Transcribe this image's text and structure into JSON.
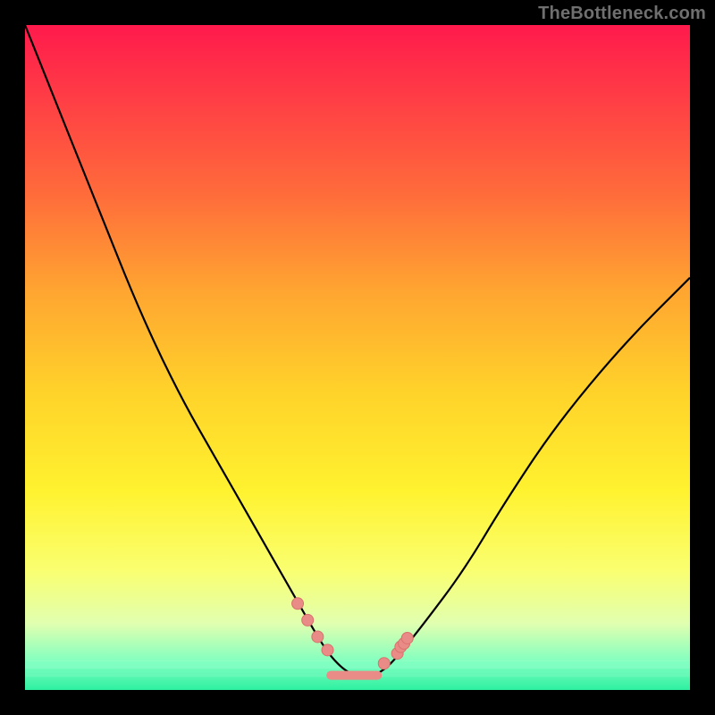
{
  "watermark": "TheBottleneck.com",
  "colors": {
    "black": "#000000",
    "curve": "#000000",
    "marker_fill": "#e98b86",
    "marker_stroke": "#d9726c",
    "marker_segment": "#e98b86"
  },
  "chart_data": {
    "type": "line",
    "title": "",
    "xlabel": "",
    "ylabel": "",
    "xlim": [
      0,
      100
    ],
    "ylim": [
      0,
      100
    ],
    "grid": false,
    "legend": false,
    "series": [
      {
        "name": "bottleneck-curve",
        "x": [
          0,
          4,
          8,
          12,
          16,
          20,
          24,
          28,
          32,
          36,
          40,
          44,
          46,
          48,
          50,
          52,
          54,
          56,
          60,
          66,
          72,
          80,
          90,
          100
        ],
        "y": [
          100,
          90,
          80,
          70,
          60,
          51,
          43,
          36,
          29,
          22,
          15,
          8,
          5,
          3,
          2,
          2,
          3,
          5,
          10,
          18,
          28,
          40,
          52,
          62
        ]
      }
    ],
    "markers": [
      {
        "x": 41.0,
        "y": 13.0
      },
      {
        "x": 42.5,
        "y": 10.5
      },
      {
        "x": 44.0,
        "y": 8.0
      },
      {
        "x": 45.5,
        "y": 6.0
      },
      {
        "x": 54.0,
        "y": 4.0
      },
      {
        "x": 56.0,
        "y": 5.5
      },
      {
        "x": 56.5,
        "y": 6.5
      },
      {
        "x": 57.0,
        "y": 7.0
      },
      {
        "x": 57.5,
        "y": 7.8
      }
    ],
    "bottom_segment": {
      "x_start": 46,
      "x_end": 53,
      "y": 2.2
    },
    "annotations": []
  }
}
